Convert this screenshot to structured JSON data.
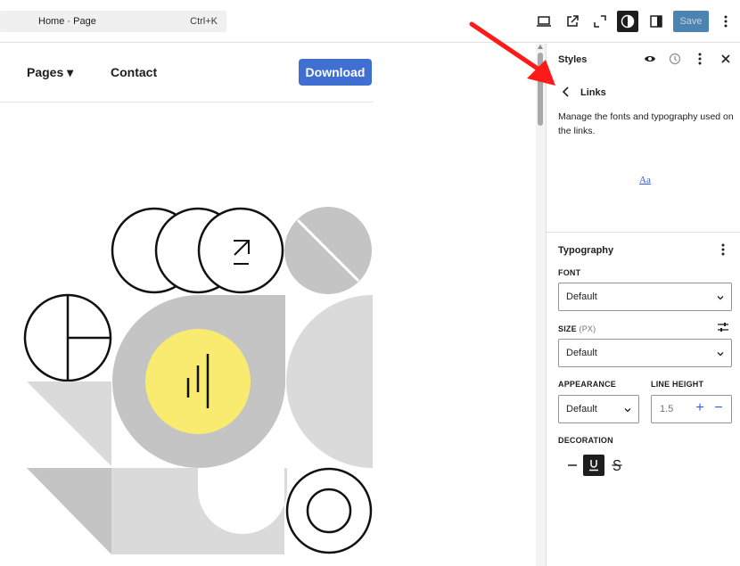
{
  "topbar": {
    "breadcrumb": "Home · Page",
    "shortcut": "Ctrl+K",
    "save_label": "Save"
  },
  "canvas": {
    "nav": {
      "pages_label": "Pages ▾",
      "contact_label": "Contact",
      "download_label": "Download"
    }
  },
  "panel": {
    "title": "Styles",
    "screen_title": "Links",
    "description": "Manage the fonts and typography used on the links.",
    "preview_text": "Aa",
    "typography": {
      "title": "Typography",
      "font_label": "FONT",
      "font_value": "Default",
      "size_label": "SIZE",
      "size_unit": "(PX)",
      "size_value": "Default",
      "appearance_label": "APPEARANCE",
      "appearance_value": "Default",
      "line_height_label": "LINE HEIGHT",
      "line_height_value": "1.5",
      "decoration_label": "DECORATION"
    }
  },
  "colors": {
    "accent": "#3858e9",
    "save_bg": "#2f6ea3",
    "download_bg": "#3f6fd1",
    "annotation_arrow": "#ff1a1a",
    "art_yellow": "#f9eb6f",
    "art_gray": "#c4c4c4"
  }
}
